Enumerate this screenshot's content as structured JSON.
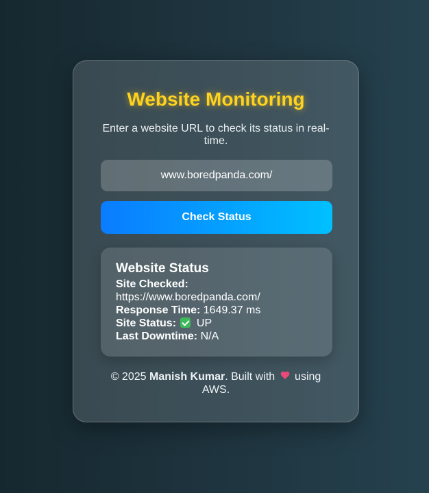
{
  "header": {
    "title": "Website Monitoring",
    "subtitle": "Enter a website URL to check its status in real-time."
  },
  "form": {
    "url_value": "www.boredpanda.com/",
    "check_button_label": "Check Status"
  },
  "status": {
    "heading": "Website Status",
    "site_checked_label": "Site Checked:",
    "site_checked_value": "https://www.boredpanda.com/",
    "response_time_label": "Response Time:",
    "response_time_value": "1649.37 ms",
    "site_status_label": "Site Status:",
    "site_status_value": "UP",
    "site_status_icon": "check-mark-icon",
    "last_downtime_label": "Last Downtime:",
    "last_downtime_value": "N/A"
  },
  "footer": {
    "copyright_prefix": "© 2025",
    "author": "Manish Kumar",
    "built_with": ". Built with",
    "heart_icon": "heart-icon",
    "suffix": "using AWS."
  },
  "colors": {
    "title": "#ffd21f",
    "button_start": "#0a7cff",
    "button_end": "#00c0ff",
    "status_up": "#3dba5a",
    "heart": "#e94a7a"
  }
}
